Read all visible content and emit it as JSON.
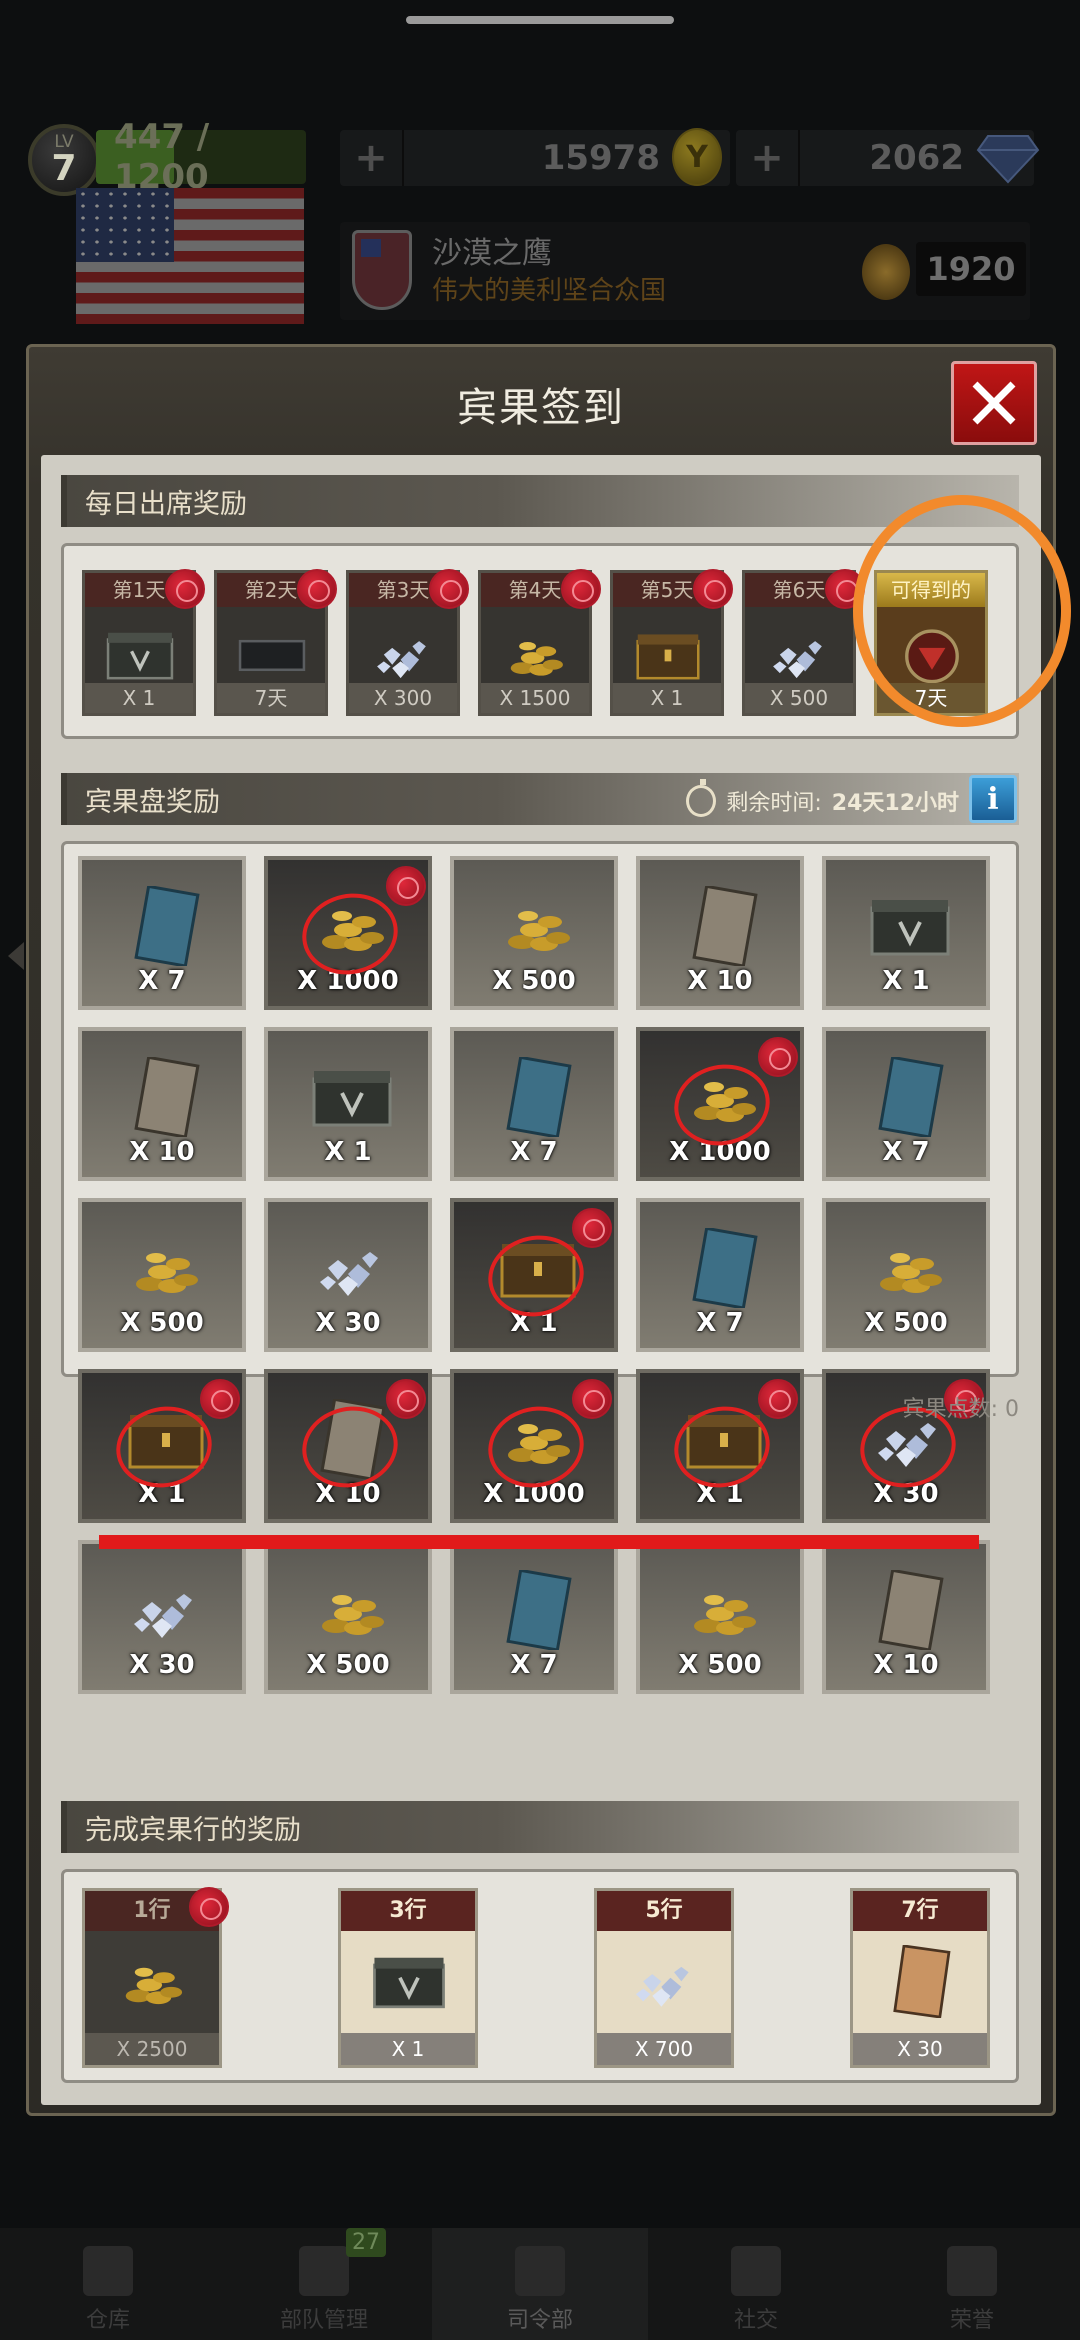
{
  "hud": {
    "level_label": "LV",
    "level": "7",
    "xp": "447 / 1200",
    "xp_fraction": 0.3725,
    "gold": "15978",
    "diamonds": "2062",
    "plus": "+",
    "player_name": "沙漠之鹰",
    "country": "伟大的美利坚合众国",
    "medal_points": "1920"
  },
  "modal": {
    "title": "宾果签到",
    "close_label": "X",
    "daily": {
      "header": "每日出席奖励",
      "days": [
        {
          "label": "第1天",
          "qty": "X 1",
          "icon": "crate-icon",
          "claimed": true
        },
        {
          "label": "第2天",
          "qty": "7天",
          "icon": "black-card-icon",
          "claimed": true
        },
        {
          "label": "第3天",
          "qty": "X 300",
          "icon": "diamonds-icon",
          "claimed": true
        },
        {
          "label": "第4天",
          "qty": "X 1500",
          "icon": "gold-coins-icon",
          "claimed": true
        },
        {
          "label": "第5天",
          "qty": "X 1",
          "icon": "gold-chest-icon",
          "claimed": true
        },
        {
          "label": "第6天",
          "qty": "X 500",
          "icon": "diamonds-icon",
          "claimed": true
        },
        {
          "label": "可得到的",
          "qty": "7天",
          "icon": "vip-medal-icon",
          "claimed": false
        }
      ]
    },
    "bingo": {
      "header": "宾果盘奖励",
      "time_label": "剩余时间:",
      "time_value": "24天12小时",
      "info_label": "i",
      "points_label": "宾果点数: 0",
      "cells": [
        {
          "qty": "X 7",
          "icon": "blue-card-icon",
          "claimed": false
        },
        {
          "qty": "X 1000",
          "icon": "gold-coins-icon",
          "claimed": true
        },
        {
          "qty": "X 500",
          "icon": "gold-coins-icon",
          "claimed": false
        },
        {
          "qty": "X 10",
          "icon": "tan-card-icon",
          "claimed": false
        },
        {
          "qty": "X 1",
          "icon": "crate-icon",
          "claimed": false
        },
        {
          "qty": "X 10",
          "icon": "tan-card-icon",
          "claimed": false
        },
        {
          "qty": "X 1",
          "icon": "crate-icon",
          "claimed": false
        },
        {
          "qty": "X 7",
          "icon": "blue-card-icon",
          "claimed": false
        },
        {
          "qty": "X 1000",
          "icon": "gold-coins-icon",
          "claimed": true
        },
        {
          "qty": "X 7",
          "icon": "blue-card-icon",
          "claimed": false
        },
        {
          "qty": "X 500",
          "icon": "gold-coins-icon",
          "claimed": false
        },
        {
          "qty": "X 30",
          "icon": "diamonds-icon",
          "claimed": false
        },
        {
          "qty": "X 1",
          "icon": "gold-chest-icon",
          "claimed": true
        },
        {
          "qty": "X 7",
          "icon": "blue-card-icon",
          "claimed": false
        },
        {
          "qty": "X 500",
          "icon": "gold-coins-icon",
          "claimed": false
        },
        {
          "qty": "X 1",
          "icon": "gold-chest-icon",
          "claimed": true
        },
        {
          "qty": "X 10",
          "icon": "tan-card-icon",
          "claimed": true
        },
        {
          "qty": "X 1000",
          "icon": "gold-coins-icon",
          "claimed": true
        },
        {
          "qty": "X 1",
          "icon": "gold-chest-icon",
          "claimed": true
        },
        {
          "qty": "X 30",
          "icon": "diamonds-icon",
          "claimed": true
        },
        {
          "qty": "X 30",
          "icon": "diamonds-icon",
          "claimed": false
        },
        {
          "qty": "X 500",
          "icon": "gold-coins-icon",
          "claimed": false
        },
        {
          "qty": "X 7",
          "icon": "blue-card-icon",
          "claimed": false
        },
        {
          "qty": "X 500",
          "icon": "gold-coins-icon",
          "claimed": false
        },
        {
          "qty": "X 10",
          "icon": "tan-card-icon",
          "claimed": false
        }
      ]
    },
    "rows": {
      "header": "完成宾果行的奖励",
      "rewards": [
        {
          "label": "1行",
          "qty": "X 2500",
          "icon": "gold-coins-icon",
          "claimed": true
        },
        {
          "label": "3行",
          "qty": "X 1",
          "icon": "crate-icon",
          "claimed": false
        },
        {
          "label": "5行",
          "qty": "X 700",
          "icon": "diamonds-icon",
          "claimed": false
        },
        {
          "label": "7行",
          "qty": "X 30",
          "icon": "bronze-card-icon",
          "claimed": false
        }
      ]
    }
  },
  "bottom_nav": {
    "items": [
      {
        "label": "仓库",
        "icon": "warehouse-icon"
      },
      {
        "label": "部队管理",
        "icon": "troops-icon",
        "badge": "27"
      },
      {
        "label": "司令部",
        "icon": "hq-icon"
      },
      {
        "label": "社交",
        "icon": "social-icon"
      },
      {
        "label": "荣誉",
        "icon": "trophy-icon"
      }
    ]
  }
}
